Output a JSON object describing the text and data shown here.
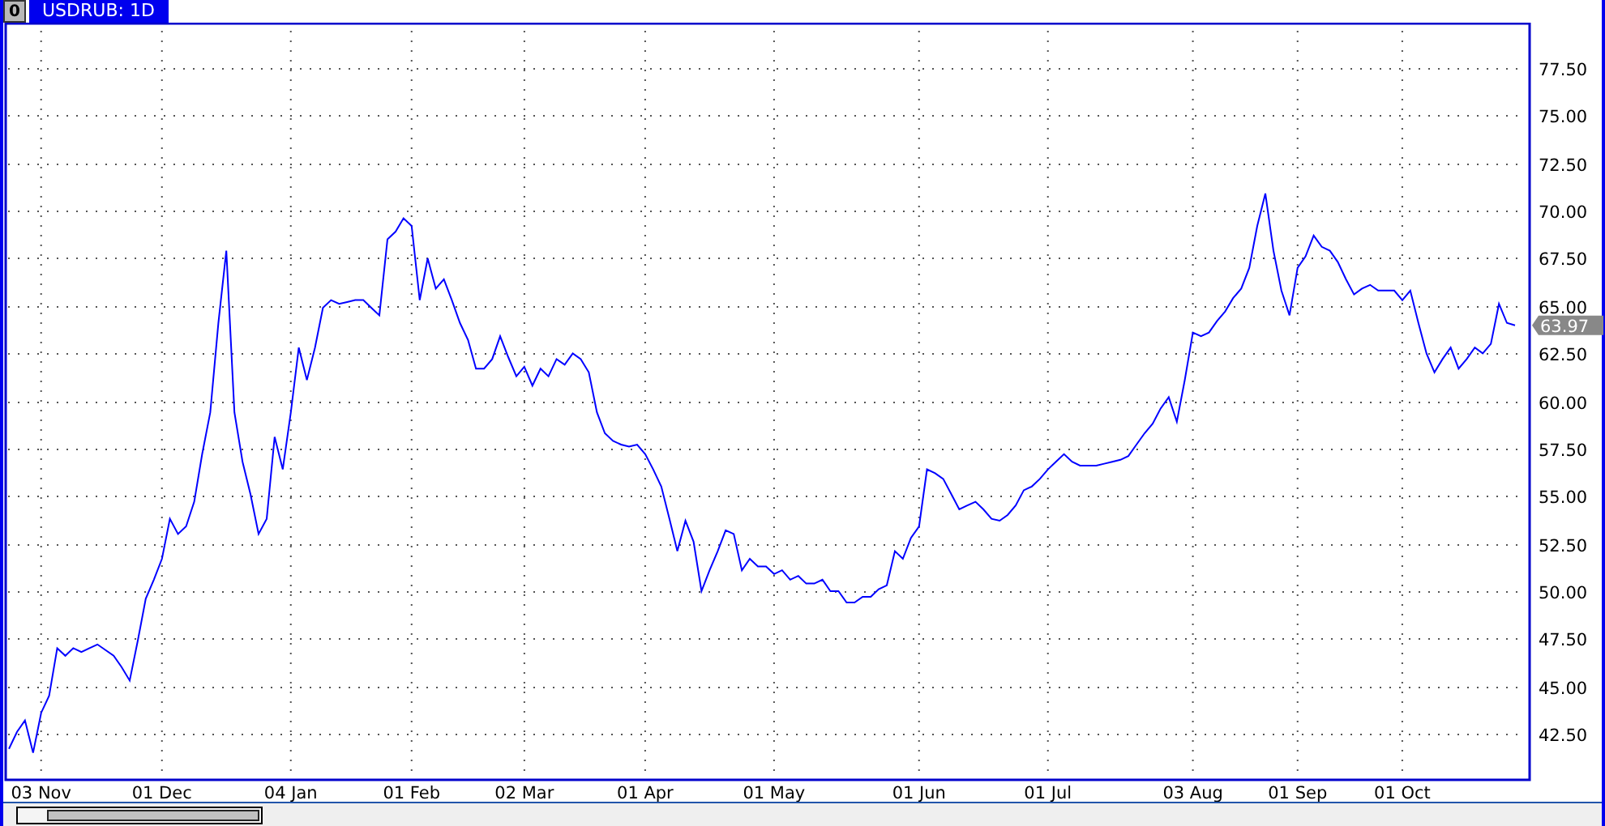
{
  "window_button": {
    "label": "0"
  },
  "tabs": [
    {
      "label": "USDRUB: 1D",
      "selected": true
    }
  ],
  "chart": {
    "chart_data": {
      "type": "line",
      "categories": [
        null,
        null,
        null,
        null,
        "03 Nov",
        null,
        null,
        null,
        null,
        null,
        null,
        null,
        null,
        null,
        null,
        null,
        null,
        null,
        null,
        "01 Dec",
        null,
        null,
        null,
        null,
        null,
        null,
        null,
        null,
        null,
        null,
        null,
        null,
        null,
        null,
        null,
        "04 Jan",
        null,
        null,
        null,
        null,
        null,
        null,
        null,
        null,
        null,
        null,
        null,
        null,
        null,
        null,
        "01 Feb",
        null,
        null,
        null,
        null,
        null,
        null,
        null,
        null,
        null,
        null,
        null,
        null,
        null,
        "02 Mar",
        null,
        null,
        null,
        null,
        null,
        null,
        null,
        null,
        null,
        null,
        null,
        null,
        null,
        null,
        "01 Apr",
        null,
        null,
        null,
        null,
        null,
        null,
        null,
        null,
        null,
        null,
        null,
        null,
        null,
        null,
        null,
        "01 May",
        null,
        null,
        null,
        null,
        null,
        null,
        null,
        null,
        null,
        null,
        null,
        null,
        null,
        null,
        null,
        null,
        null,
        "01 Jun",
        null,
        null,
        null,
        null,
        null,
        null,
        null,
        null,
        null,
        null,
        null,
        null,
        null,
        null,
        null,
        "01 Jul",
        null,
        null,
        null,
        null,
        null,
        null,
        null,
        null,
        null,
        null,
        null,
        null,
        null,
        null,
        null,
        null,
        null,
        "03 Aug",
        null,
        null,
        null,
        null,
        null,
        null,
        null,
        null,
        null,
        null,
        null,
        null,
        "01 Sep",
        null,
        null,
        null,
        null,
        null,
        null,
        null,
        null,
        null,
        null,
        null,
        null,
        "01 Oct",
        null,
        null,
        null,
        null,
        null,
        null,
        null,
        null,
        null,
        null,
        null,
        null,
        null,
        null
      ],
      "series": [
        {
          "color": "#0000ff",
          "values": [
            41.7,
            42.6,
            43.2,
            41.5,
            43.6,
            44.5,
            47.0,
            46.6,
            47.0,
            46.8,
            47.0,
            47.2,
            46.9,
            46.6,
            46.0,
            45.3,
            47.4,
            49.6,
            50.6,
            51.7,
            53.8,
            53.0,
            53.4,
            54.7,
            57.2,
            59.4,
            64.1,
            67.9,
            59.4,
            56.8,
            55.1,
            53.0,
            53.8,
            58.1,
            56.4,
            59.4,
            62.8,
            61.1,
            62.8,
            64.9,
            65.3,
            65.1,
            65.2,
            65.3,
            65.3,
            64.9,
            64.5,
            68.5,
            68.9,
            69.6,
            69.2,
            65.3,
            67.5,
            65.9,
            66.4,
            65.3,
            64.1,
            63.2,
            61.7,
            61.7,
            62.2,
            63.4,
            62.3,
            61.3,
            61.8,
            60.8,
            61.7,
            61.3,
            62.2,
            61.9,
            62.5,
            62.2,
            61.5,
            59.4,
            58.3,
            57.9,
            57.7,
            57.6,
            57.7,
            57.2,
            56.4,
            55.5,
            53.8,
            52.1,
            53.7,
            52.6,
            50.0,
            51.1,
            52.1,
            53.2,
            53.0,
            51.1,
            51.7,
            51.3,
            51.3,
            50.9,
            51.1,
            50.6,
            50.8,
            50.4,
            50.4,
            50.6,
            50.0,
            50.0,
            49.4,
            49.4,
            49.7,
            49.7,
            50.1,
            50.3,
            52.1,
            51.7,
            52.8,
            53.4,
            56.4,
            56.2,
            55.9,
            55.1,
            54.3,
            54.5,
            54.7,
            54.3,
            53.8,
            53.7,
            54.0,
            54.5,
            55.3,
            55.5,
            55.9,
            56.4,
            56.8,
            57.2,
            56.8,
            56.6,
            56.6,
            56.6,
            56.7,
            56.8,
            56.9,
            57.1,
            57.7,
            58.3,
            58.8,
            59.6,
            60.2,
            58.9,
            61.1,
            63.6,
            63.4,
            63.6,
            64.2,
            64.7,
            65.4,
            65.9,
            67.0,
            69.2,
            70.9,
            67.9,
            65.8,
            64.5,
            67.0,
            67.6,
            68.7,
            68.1,
            67.9,
            67.3,
            66.4,
            65.6,
            65.9,
            66.1,
            65.8,
            65.8,
            65.8,
            65.3,
            65.8,
            64.1,
            62.5,
            61.5,
            62.2,
            62.8,
            61.7,
            62.2,
            62.8,
            62.5,
            63.0,
            65.1,
            64.1,
            63.97
          ]
        }
      ],
      "ylim": [
        40.12,
        79.8
      ],
      "grid": true,
      "yticks": [
        {
          "value": 42.5,
          "label": "42.50"
        },
        {
          "value": 45,
          "label": "45.00"
        },
        {
          "value": 47.5,
          "label": "47.50"
        },
        {
          "value": 50,
          "label": "50.00"
        },
        {
          "value": 52.5,
          "label": "52.50"
        },
        {
          "value": 55,
          "label": "55.00"
        },
        {
          "value": 57.5,
          "label": "57.50"
        },
        {
          "value": 60,
          "label": "60.00"
        },
        {
          "value": 62.5,
          "label": "62.50"
        },
        {
          "value": 65,
          "label": "65.00"
        },
        {
          "value": 67.5,
          "label": "67.50"
        },
        {
          "value": 70,
          "label": "70.00"
        },
        {
          "value": 72.5,
          "label": "72.50"
        },
        {
          "value": 75,
          "label": "75.00"
        },
        {
          "value": 77.5,
          "label": "77.50"
        }
      ]
    },
    "price_tag": {
      "label": "63.97"
    }
  }
}
